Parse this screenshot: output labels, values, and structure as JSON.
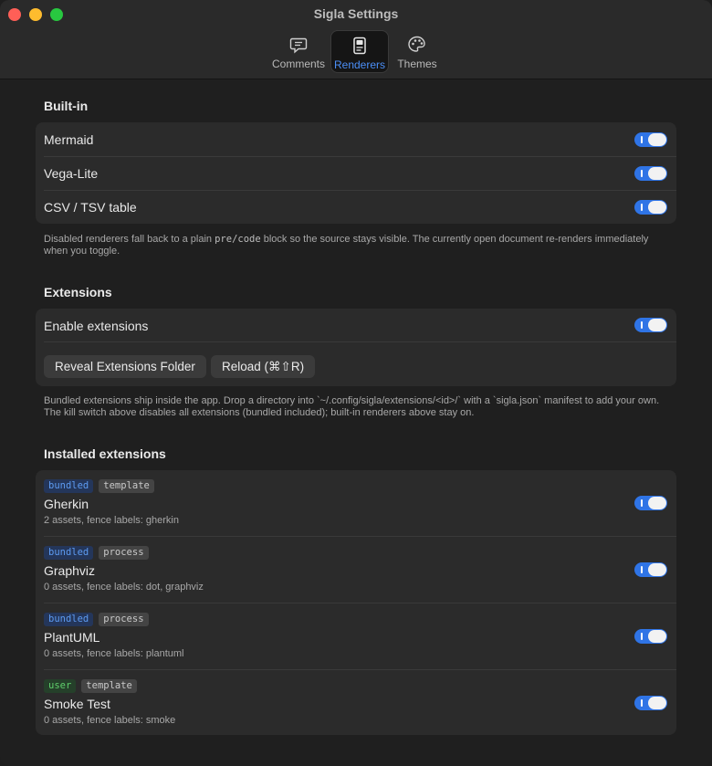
{
  "window": {
    "title": "Sigla Settings"
  },
  "tabs": [
    {
      "label": "Comments",
      "icon": "comment-bubble-icon",
      "active": false
    },
    {
      "label": "Renderers",
      "icon": "renderer-document-icon",
      "active": true
    },
    {
      "label": "Themes",
      "icon": "palette-icon",
      "active": false
    }
  ],
  "builtin": {
    "title": "Built-in",
    "items": [
      {
        "label": "Mermaid",
        "enabled": true
      },
      {
        "label": "Vega-Lite",
        "enabled": true
      },
      {
        "label": "CSV / TSV table",
        "enabled": true
      }
    ],
    "note_pre": "Disabled renderers fall back to a plain ",
    "note_code": "pre/code",
    "note_post": " block so the source stays visible. The currently open document re-renders immediately when you toggle."
  },
  "extensions": {
    "title": "Extensions",
    "enable_label": "Enable extensions",
    "enabled": true,
    "reveal_button": "Reveal Extensions Folder",
    "reload_button": "Reload (⌘⇧R)",
    "note": "Bundled extensions ship inside the app. Drop a directory into `~/.config/sigla/extensions/<id>/` with a `sigla.json` manifest to add your own. The kill switch above disables all extensions (bundled included); built-in renderers above stay on."
  },
  "installed": {
    "title": "Installed extensions",
    "items": [
      {
        "source": "bundled",
        "kind": "template",
        "name": "Gherkin",
        "details": "2 assets, fence labels: gherkin",
        "enabled": true
      },
      {
        "source": "bundled",
        "kind": "process",
        "name": "Graphviz",
        "details": "0 assets, fence labels: dot, graphviz",
        "enabled": true
      },
      {
        "source": "bundled",
        "kind": "process",
        "name": "PlantUML",
        "details": "0 assets, fence labels: plantuml",
        "enabled": true
      },
      {
        "source": "user",
        "kind": "template",
        "name": "Smoke Test",
        "details": "0 assets, fence labels: smoke",
        "enabled": true
      }
    ]
  },
  "colors": {
    "accent": "#2f74e6",
    "active_tab_label": "#4b8ff7",
    "bundled_badge": "#5d9bf2",
    "user_badge": "#5fcf6c"
  }
}
